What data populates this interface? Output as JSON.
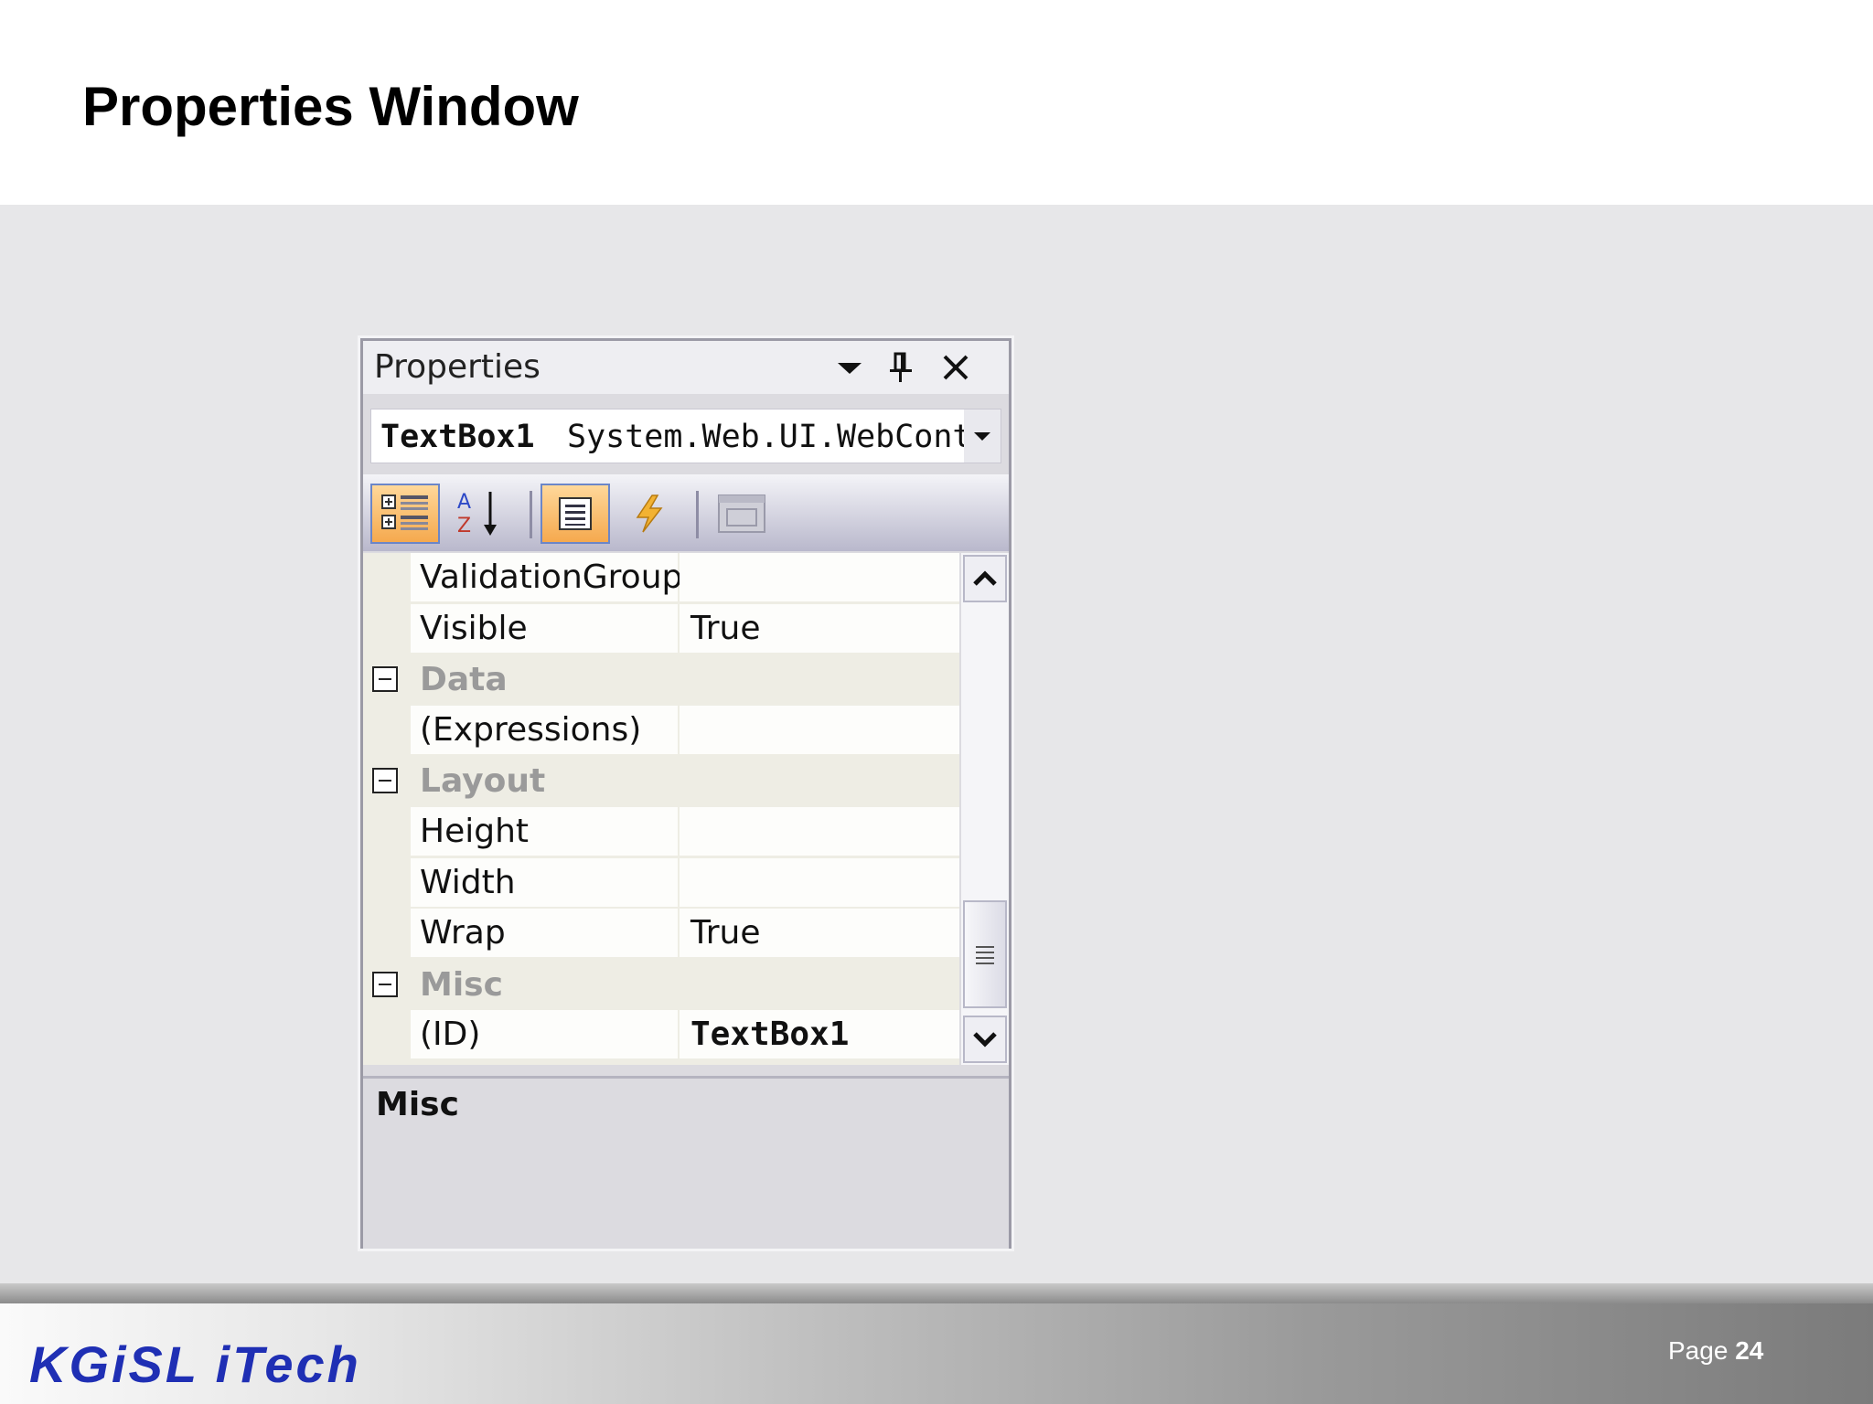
{
  "slide": {
    "title": "Properties Window",
    "logo_text": "KGiSL iTech",
    "page_label": "Page",
    "page_number": "24"
  },
  "properties_window": {
    "title": "Properties",
    "icons": {
      "dropdown": "chevron-down-icon",
      "pin": "pin-icon",
      "close": "close-icon"
    },
    "object_selector": {
      "name": "TextBox1",
      "type": "System.Web.UI.WebCont"
    },
    "toolbar": [
      "categorized-icon",
      "alphabetical-icon",
      "properties-icon",
      "events-icon",
      "property-pages-icon"
    ],
    "rows": [
      {
        "kind": "prop",
        "name": "ValidationGroup",
        "value": ""
      },
      {
        "kind": "prop",
        "name": "Visible",
        "value": "True"
      },
      {
        "kind": "cat",
        "name": "Data"
      },
      {
        "kind": "prop",
        "name": "(Expressions)",
        "value": ""
      },
      {
        "kind": "cat",
        "name": "Layout"
      },
      {
        "kind": "prop",
        "name": "Height",
        "value": ""
      },
      {
        "kind": "prop",
        "name": "Width",
        "value": ""
      },
      {
        "kind": "prop",
        "name": "Wrap",
        "value": "True"
      },
      {
        "kind": "cat",
        "name": "Misc"
      },
      {
        "kind": "prop",
        "name": "(ID)",
        "value": "TextBox1"
      }
    ],
    "description_title": "Misc"
  },
  "colors": {
    "logo": "#1f2fb4",
    "category_label": "#9a9a9a",
    "active_button": "#f5a94e"
  }
}
